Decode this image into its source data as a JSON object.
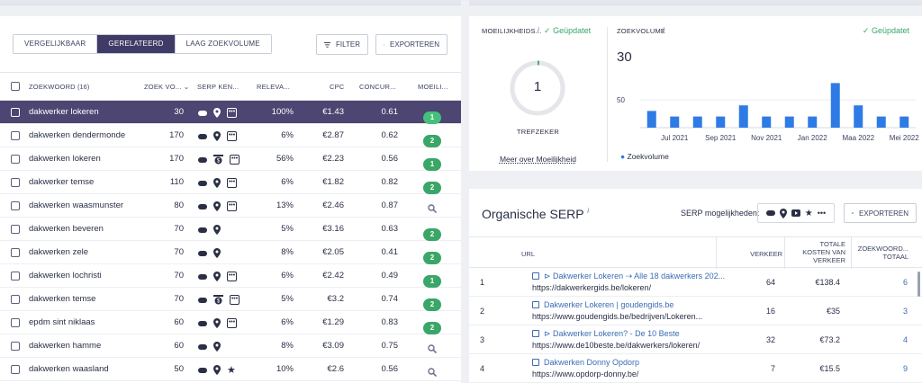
{
  "tabs": [
    {
      "label": "VERGELIJKBAAR",
      "active": false
    },
    {
      "label": "GERELATEERD",
      "active": true
    },
    {
      "label": "LAAG ZOEKVOLUME",
      "active": false
    }
  ],
  "toolbar": {
    "filter_label": "FILTER",
    "export_label": "EXPORTEREN"
  },
  "columns": {
    "keyword": "ZOEKWOORD",
    "keyword_count": "(16)",
    "volume": "ZOEK VO...",
    "serp": "SERP KEN...",
    "relevance": "RELEVA...",
    "cpc": "CPC",
    "competition": "CONCUR...",
    "difficulty": "MOEILI..."
  },
  "rows": [
    {
      "kw": "dakwerker lokeren",
      "vol": "30",
      "serp": [
        "pill",
        "pin",
        "dots"
      ],
      "rel": "100%",
      "cpc": "€1.43",
      "con": "0.61",
      "dif": "1",
      "dif_type": "badge",
      "selected": true
    },
    {
      "kw": "dakwerken dendermonde",
      "vol": "170",
      "serp": [
        "pill",
        "pin",
        "dots"
      ],
      "rel": "6%",
      "cpc": "€2.87",
      "con": "0.62",
      "dif": "2",
      "dif_type": "badge",
      "selected": false
    },
    {
      "kw": "dakwerken lokeren",
      "vol": "170",
      "serp": [
        "pill",
        "ad",
        "dots"
      ],
      "rel": "56%",
      "cpc": "€2.23",
      "con": "0.56",
      "dif": "1",
      "dif_type": "badge",
      "selected": false
    },
    {
      "kw": "dakwerker temse",
      "vol": "110",
      "serp": [
        "pill",
        "pin",
        "dots"
      ],
      "rel": "6%",
      "cpc": "€1.82",
      "con": "0.82",
      "dif": "2",
      "dif_type": "badge",
      "selected": false
    },
    {
      "kw": "dakwerken waasmunster",
      "vol": "80",
      "serp": [
        "pill",
        "pin",
        "dots"
      ],
      "rel": "13%",
      "cpc": "€2.46",
      "con": "0.87",
      "dif": "",
      "dif_type": "search",
      "selected": false
    },
    {
      "kw": "dakwerken beveren",
      "vol": "70",
      "serp": [
        "pill",
        "pin"
      ],
      "rel": "5%",
      "cpc": "€3.16",
      "con": "0.63",
      "dif": "2",
      "dif_type": "badge",
      "selected": false
    },
    {
      "kw": "dakwerken zele",
      "vol": "70",
      "serp": [
        "pill",
        "pin"
      ],
      "rel": "8%",
      "cpc": "€2.05",
      "con": "0.41",
      "dif": "2",
      "dif_type": "badge",
      "selected": false
    },
    {
      "kw": "dakwerken lochristi",
      "vol": "70",
      "serp": [
        "pill",
        "pin",
        "dots"
      ],
      "rel": "6%",
      "cpc": "€2.42",
      "con": "0.49",
      "dif": "1",
      "dif_type": "badge",
      "selected": false
    },
    {
      "kw": "dakwerken temse",
      "vol": "70",
      "serp": [
        "pill",
        "ad",
        "dots"
      ],
      "rel": "5%",
      "cpc": "€3.2",
      "con": "0.74",
      "dif": "2",
      "dif_type": "badge",
      "selected": false
    },
    {
      "kw": "epdm sint niklaas",
      "vol": "60",
      "serp": [
        "pill",
        "pin",
        "dots"
      ],
      "rel": "6%",
      "cpc": "€1.29",
      "con": "0.83",
      "dif": "2",
      "dif_type": "badge",
      "selected": false
    },
    {
      "kw": "dakwerken hamme",
      "vol": "60",
      "serp": [
        "pill",
        "pin"
      ],
      "rel": "8%",
      "cpc": "€3.09",
      "con": "0.75",
      "dif": "",
      "dif_type": "search",
      "selected": false
    },
    {
      "kw": "dakwerken waasland",
      "vol": "50",
      "serp": [
        "pill",
        "pin",
        "star"
      ],
      "rel": "10%",
      "cpc": "€2.6",
      "con": "0.56",
      "dif": "",
      "dif_type": "search",
      "selected": false
    }
  ],
  "difficulty_card": {
    "label": "MOEILIJKHEIDS...",
    "info": "i",
    "updated": "Geüpdatet",
    "value": "1",
    "level": "TREFZEKER",
    "link": "Meer over Moeilijkheid"
  },
  "volume_card": {
    "label": "ZOEKVOLUME",
    "info": "i",
    "updated": "Geüpdatet",
    "value": "30",
    "legend": "Zoekvolume"
  },
  "chart_data": {
    "type": "bar",
    "categories": [
      "",
      "Jul 2021",
      "",
      "Sep 2021",
      "",
      "Nov 2021",
      "",
      "Jan 2022",
      "",
      "Maa 2022",
      "",
      "Mei 2022"
    ],
    "values": [
      30,
      20,
      20,
      20,
      40,
      20,
      20,
      20,
      80,
      40,
      20,
      20
    ],
    "ylim": [
      0,
      100
    ],
    "yticks": [
      50
    ],
    "title": "",
    "xlabel": "",
    "ylabel": "",
    "grid": true,
    "color": "#2f7be5"
  },
  "serp": {
    "title": "Organische SERP",
    "info": "i",
    "features_label": "SERP mogelijkheden:",
    "export_label": "EXPORTEREN",
    "columns": {
      "url": "URL",
      "traffic": "VERKEER",
      "cost_line1": "TOTALE",
      "cost_line2": "KOSTEN VAN",
      "cost_line3": "VERKEER",
      "kw_line1": "ZOEKWOORD...",
      "kw_line2": "TOTAAL"
    },
    "rows": [
      {
        "n": "1",
        "title": "⊳ Dakwerker Lokeren ⇢ Alle 18 dakwerkers 202...",
        "url": "https://dakwerkergids.be/lokeren/",
        "traffic": "64",
        "cost": "€138.4",
        "kw": "6"
      },
      {
        "n": "2",
        "title": "Dakwerker Lokeren | goudengids.be",
        "url": "https://www.goudengids.be/bedrijven/Lokeren...",
        "traffic": "16",
        "cost": "€35",
        "kw": "3"
      },
      {
        "n": "3",
        "title": "⊳ Dakwerker Lokeren? - De 10 Beste",
        "url": "https://www.de10beste.be/dakwerkers/lokeren/",
        "traffic": "32",
        "cost": "€73.2",
        "kw": "4"
      },
      {
        "n": "4",
        "title": "Dakwerken Donny Opdorp",
        "url": "https://www.opdorp-donny.be/",
        "traffic": "7",
        "cost": "€15.5",
        "kw": "9"
      }
    ]
  },
  "colors": {
    "accent": "#3f3a66",
    "selected_row": "#4d4572",
    "badge_green": "#3aa668",
    "bar_blue": "#2f7be5",
    "link_blue": "#3b6cb3"
  }
}
